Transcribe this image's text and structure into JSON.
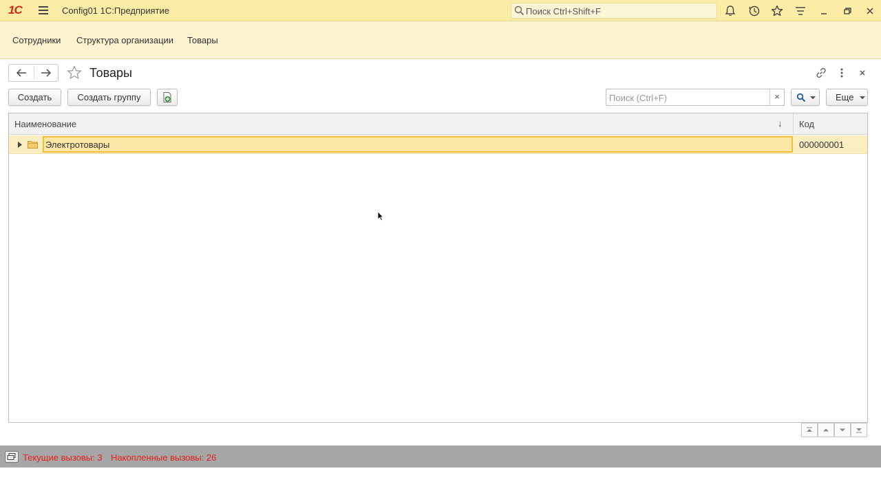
{
  "window": {
    "logo": "1С",
    "title": "Config01 1С:Предприятие",
    "search_placeholder": "Поиск Ctrl+Shift+F"
  },
  "sections": [
    "Сотрудники",
    "Структура организации",
    "Товары"
  ],
  "form": {
    "title": "Товары"
  },
  "toolbar": {
    "create_label": "Создать",
    "create_group_label": "Создать группу",
    "search_placeholder": "Поиск (Ctrl+F)",
    "search_clear": "×",
    "more_label": "Еще"
  },
  "table": {
    "columns": [
      "Наименование",
      "Код"
    ],
    "sort_indicator": "↓",
    "rows": [
      {
        "name": "Электротовары",
        "code": "000000001"
      }
    ]
  },
  "status": {
    "current_calls": "Текущие вызовы: 3",
    "accumulated_calls": "Накопленные вызовы: 26"
  },
  "colors": {
    "titlebar": "#fbeca6",
    "sections_panel": "#fbf2d0",
    "selected_row": "#fbeec0",
    "selected_cell_border": "#f0bd3c",
    "status_bar": "#a6a6a6",
    "status_text": "#e8211b",
    "logo": "#d8261c"
  }
}
